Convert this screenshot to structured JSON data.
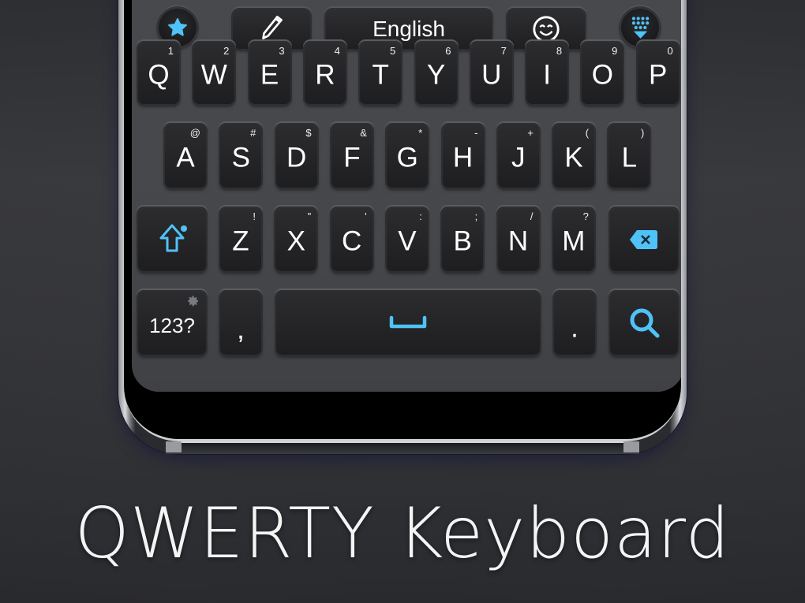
{
  "toolbar": {
    "favorites_icon": "star-icon",
    "handwriting_icon": "pencil-icon",
    "language_label": "English",
    "emoji_icon": "smiley-icon",
    "hide_keyboard_icon": "keypad-hide-icon"
  },
  "rows": [
    [
      {
        "main": "Q",
        "sup": "1"
      },
      {
        "main": "W",
        "sup": "2"
      },
      {
        "main": "E",
        "sup": "3"
      },
      {
        "main": "R",
        "sup": "4"
      },
      {
        "main": "T",
        "sup": "5"
      },
      {
        "main": "Y",
        "sup": "6"
      },
      {
        "main": "U",
        "sup": "7"
      },
      {
        "main": "I",
        "sup": "8"
      },
      {
        "main": "O",
        "sup": "9"
      },
      {
        "main": "P",
        "sup": "0"
      }
    ],
    [
      {
        "main": "A",
        "sup": "@"
      },
      {
        "main": "S",
        "sup": "#"
      },
      {
        "main": "D",
        "sup": "$"
      },
      {
        "main": "F",
        "sup": "&"
      },
      {
        "main": "G",
        "sup": "*"
      },
      {
        "main": "H",
        "sup": "-"
      },
      {
        "main": "J",
        "sup": "+"
      },
      {
        "main": "K",
        "sup": "("
      },
      {
        "main": "L",
        "sup": ")"
      }
    ],
    [
      {
        "main": "Z",
        "sup": "!"
      },
      {
        "main": "X",
        "sup": "\""
      },
      {
        "main": "C",
        "sup": "'"
      },
      {
        "main": "V",
        "sup": ":"
      },
      {
        "main": "B",
        "sup": ";"
      },
      {
        "main": "N",
        "sup": "/"
      },
      {
        "main": "M",
        "sup": "?"
      }
    ]
  ],
  "special_keys": {
    "shift_icon": "shift-arrow-icon",
    "backspace_icon": "backspace-icon",
    "symbols_label": "123?",
    "settings_icon": "gear-icon",
    "comma_label": ",",
    "space_icon": "spacebar-icon",
    "period_label": ".",
    "search_icon": "search-icon"
  },
  "caption": "QWERTY Keyboard",
  "colors": {
    "accent": "#4fc3f7",
    "key_bg": "#1f1f21",
    "keyboard_bg": "#46484c",
    "text": "#ffffff"
  }
}
